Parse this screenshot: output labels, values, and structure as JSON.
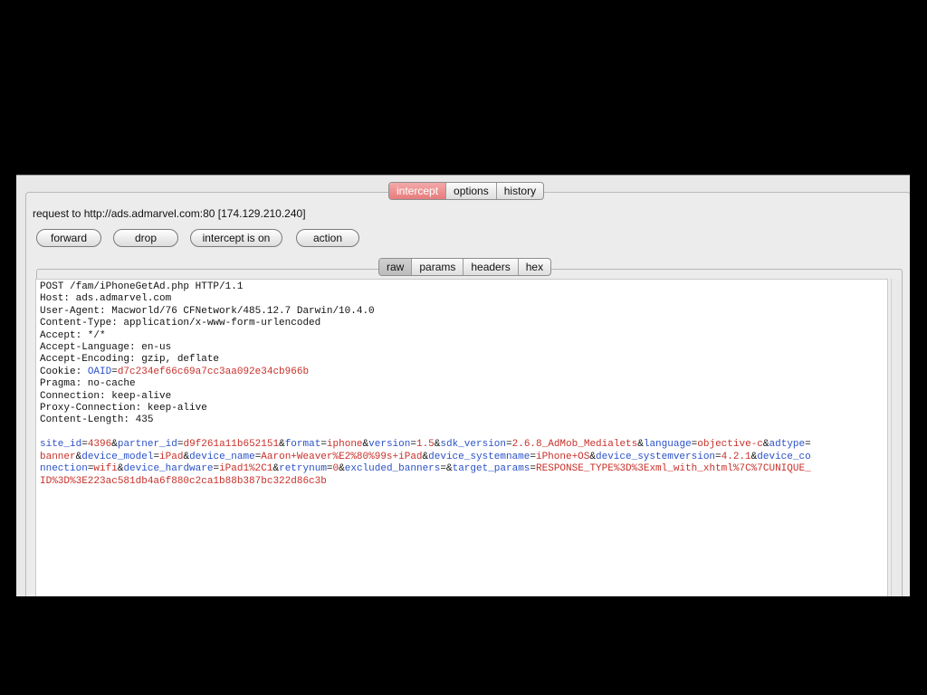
{
  "tabs_top": [
    {
      "label": "intercept",
      "selected": true
    },
    {
      "label": "options",
      "selected": false
    },
    {
      "label": "history",
      "selected": false
    }
  ],
  "request_line": "request to http://ads.admarvel.com:80  [174.129.210.240]",
  "buttons": {
    "forward": "forward",
    "drop": "drop",
    "intercept": "intercept is on",
    "action": "action"
  },
  "tabs_inner": [
    {
      "label": "raw",
      "selected": true
    },
    {
      "label": "params",
      "selected": false
    },
    {
      "label": "headers",
      "selected": false
    },
    {
      "label": "hex",
      "selected": false
    }
  ],
  "headers": {
    "l1": "POST /fam/iPhoneGetAd.php HTTP/1.1",
    "l2": "Host: ads.admarvel.com",
    "l3": "User-Agent: Macworld/76 CFNetwork/485.12.7 Darwin/10.4.0",
    "l4": "Content-Type: application/x-www-form-urlencoded",
    "l5": "Accept: */*",
    "l6": "Accept-Language: en-us",
    "l7": "Accept-Encoding: gzip, deflate",
    "cookie_prefix": "Cookie: ",
    "cookie_key": "OAID",
    "cookie_value": "d7c234ef66c69a7cc3aa092e34cb966b",
    "l9": "Pragma: no-cache",
    "l10": "Connection: keep-alive",
    "l11": "Proxy-Connection: keep-alive",
    "l12": "Content-Length: 435"
  },
  "body_params": [
    {
      "key": "site_id",
      "value": "4396"
    },
    {
      "key": "partner_id",
      "value": "d9f261a11b652151"
    },
    {
      "key": "format",
      "value": "iphone"
    },
    {
      "key": "version",
      "value": "1.5"
    },
    {
      "key": "sdk_version",
      "value": "2.6.8_AdMob_Medialets"
    },
    {
      "key": "language",
      "value": "objective-c"
    },
    {
      "key": "adtype",
      "value": "banner"
    },
    {
      "key": "device_model",
      "value": "iPad"
    },
    {
      "key": "device_name",
      "value": "Aaron+Weaver%E2%80%99s+iPad"
    },
    {
      "key": "device_systemname",
      "value": "iPhone+OS"
    },
    {
      "key": "device_systemversion",
      "value": "4.2.1"
    },
    {
      "key": "device_connection",
      "value": "wifi"
    },
    {
      "key": "device_hardware",
      "value": "iPad1%2C1"
    },
    {
      "key": "retrynum",
      "value": "0"
    },
    {
      "key": "excluded_banners",
      "value": ""
    },
    {
      "key": "target_params",
      "value": "RESPONSE_TYPE%3D%3Exml_with_xhtml%7C%7CUNIQUE_ID%3D%3E223ac581db4a6f880c2ca1b88b387bc322d86c3b"
    }
  ],
  "colors": {
    "param_key": "#2b52c8",
    "param_value": "#c8302a",
    "selected_tab": "#e77c7c"
  }
}
